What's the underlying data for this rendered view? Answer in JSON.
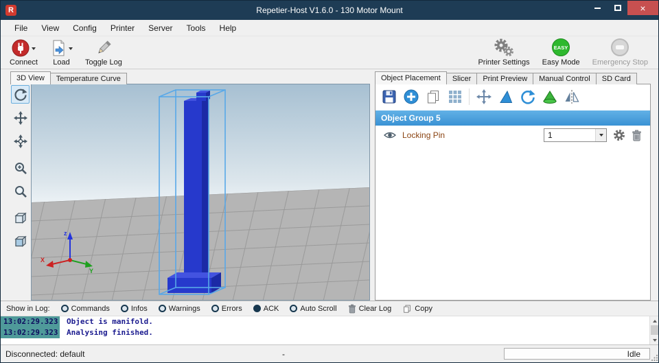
{
  "window": {
    "title": "Repetier-Host V1.6.0 - 130 Motor Mount",
    "logo_letter": "R",
    "close_glyph": "×"
  },
  "menu": {
    "items": [
      "File",
      "View",
      "Config",
      "Printer",
      "Server",
      "Tools",
      "Help"
    ]
  },
  "toolbar": {
    "connect_label": "Connect",
    "load_label": "Load",
    "toggle_log_label": "Toggle Log",
    "printer_settings_label": "Printer Settings",
    "easy_mode_label": "Easy Mode",
    "easy_badge": "EASY",
    "emergency_stop_label": "Emergency Stop"
  },
  "left_panel": {
    "tab_3d": "3D View",
    "tab_temp": "Temperature Curve"
  },
  "viewport": {
    "axis_x": "X",
    "axis_y": "Y",
    "axis_z": "z"
  },
  "right_panel": {
    "tab_placement": "Object Placement",
    "tab_slicer": "Slicer",
    "tab_preview": "Print Preview",
    "tab_manual": "Manual Control",
    "tab_sd": "SD Card",
    "group_header": "Object Group 5",
    "object_name": "Locking Pin",
    "copies_value": "1"
  },
  "log_panel": {
    "show_label": "Show in Log:",
    "toggle_commands": "Commands",
    "toggle_infos": "Infos",
    "toggle_warnings": "Warnings",
    "toggle_errors": "Errors",
    "toggle_ack": "ACK",
    "toggle_autoscroll": "Auto Scroll",
    "clear_label": "Clear Log",
    "copy_label": "Copy",
    "entries": [
      {
        "time": "13:02:29.323",
        "message": "Object is manifold."
      },
      {
        "time": "13:02:29.323",
        "message": "Analysing finished."
      }
    ]
  },
  "status_bar": {
    "connection": "Disconnected: default",
    "center_text": "-",
    "state": "Idle"
  },
  "colors": {
    "titlebar": "#1e3c55",
    "close_red": "#c75050",
    "connect_red": "#c32b2b",
    "easy_green": "#2eb82e",
    "accent_blue": "#2f8fd6",
    "group_header_top": "#62b1e6",
    "group_header_bottom": "#3a92d4",
    "object_blue": "#2639cc",
    "selection_box_blue": "#58a8e8",
    "log_time_bg": "#4f9a9a",
    "log_text": "#1b1b8f"
  }
}
